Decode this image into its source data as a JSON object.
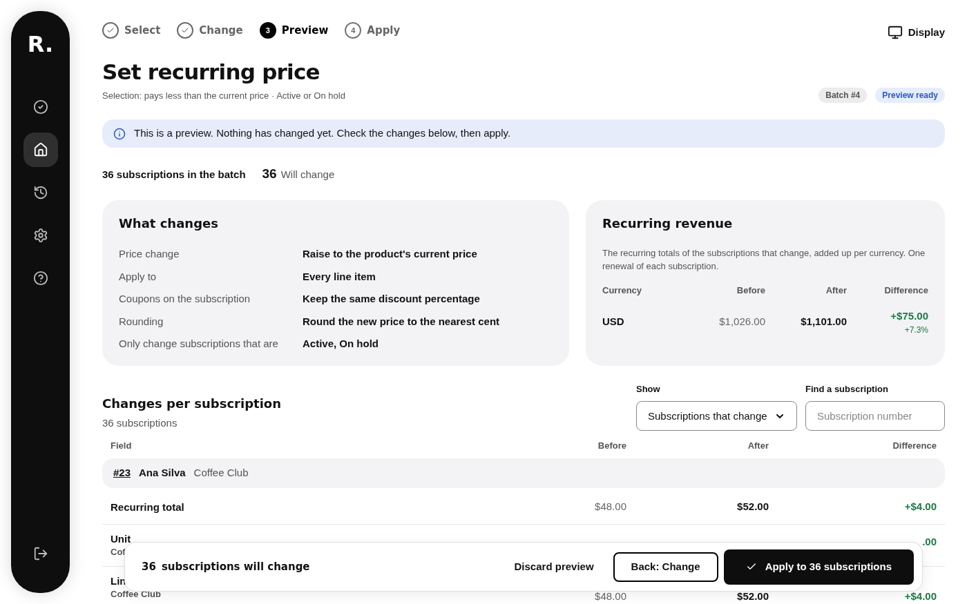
{
  "sidebar": {
    "logo": "R.",
    "items": [
      {
        "selected": false
      },
      {
        "selected": true
      },
      {
        "selected": false
      },
      {
        "selected": false
      },
      {
        "selected": false
      }
    ]
  },
  "steps": [
    {
      "label": "Select",
      "kind": "done"
    },
    {
      "label": "Change",
      "kind": "done"
    },
    {
      "label": "Preview",
      "kind": "current",
      "number": "3"
    },
    {
      "label": "Apply",
      "kind": "todo",
      "number": "4"
    }
  ],
  "display_button": "Display",
  "title": "Set recurring price",
  "subtitle": "Selection: pays less than the current price · Active or On hold",
  "badges": [
    {
      "label": "Batch #4",
      "kind": "neutral"
    },
    {
      "label": "Preview ready",
      "kind": "info"
    }
  ],
  "notice": "This is a preview. Nothing has changed yet. Check the changes below, then apply.",
  "summary": {
    "batch": "36 subscriptions in the batch",
    "count": "36",
    "count_label": "Will change"
  },
  "what_changes": {
    "title": "What changes",
    "rows": [
      {
        "label": "Price change",
        "value": "Raise to the product's current price"
      },
      {
        "label": "Apply to",
        "value": "Every line item"
      },
      {
        "label": "Coupons on the subscription",
        "value": "Keep the same discount percentage"
      },
      {
        "label": "Rounding",
        "value": "Round the new price to the nearest cent"
      },
      {
        "label": "Only change subscriptions that are",
        "value": "Active, On hold"
      }
    ]
  },
  "revenue": {
    "title": "Recurring revenue",
    "description": "The recurring totals of the subscriptions that change, added up per currency. One renewal of each subscription.",
    "columns": [
      "Currency",
      "Before",
      "After",
      "Difference"
    ],
    "rows": [
      {
        "currency": "USD",
        "before": "$1,026.00",
        "after": "$1,101.00",
        "difference": "+$75.00",
        "percent": "+7.3%"
      }
    ]
  },
  "changes": {
    "title": "Changes per subscription",
    "subtitle": "36 subscriptions",
    "show": {
      "label": "Show",
      "value": "Subscriptions that change"
    },
    "find": {
      "label": "Find a subscription",
      "placeholder": "Subscription number"
    },
    "columns": [
      "Field",
      "Before",
      "After",
      "Difference"
    ],
    "group": {
      "number": "#23",
      "name": "Ana Silva",
      "product": "Coffee Club"
    },
    "rows": [
      {
        "field": "Recurring total",
        "sub": "",
        "before": "$48.00",
        "after": "$52.00",
        "difference": "+$4.00"
      },
      {
        "field": "Unit",
        "sub": "Cof",
        "before": "",
        "after": "",
        "difference": ".00"
      },
      {
        "field": "Lin",
        "sub": "Coffee Club",
        "before": "$48.00",
        "after": "$52.00",
        "difference": "+$4.00"
      }
    ]
  },
  "action_bar": {
    "count": "36",
    "text": "subscriptions will change",
    "discard": "Discard preview",
    "back": "Back: Change",
    "apply": "Apply to 36 subscriptions"
  }
}
